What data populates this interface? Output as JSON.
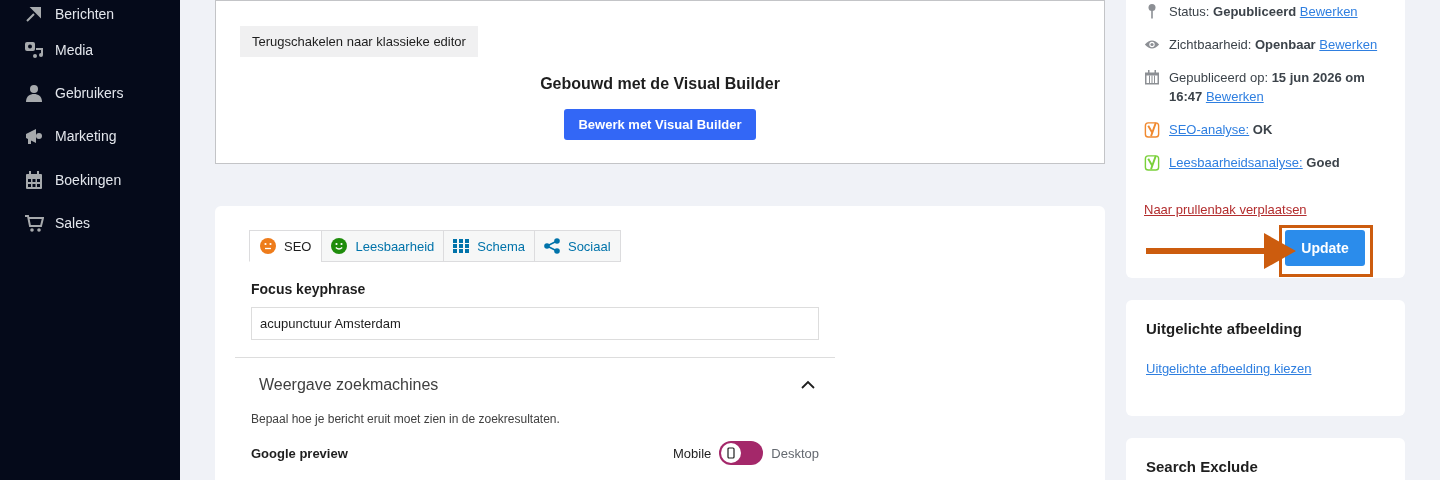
{
  "sidebar": {
    "items": [
      {
        "label": "Berichten"
      },
      {
        "label": "Media"
      },
      {
        "label": "Gebruikers"
      },
      {
        "label": "Marketing"
      },
      {
        "label": "Boekingen"
      },
      {
        "label": "Sales"
      }
    ]
  },
  "builder": {
    "switch_button": "Terugschakelen naar klassieke editor",
    "title": "Gebouwd met de Visual Builder",
    "edit_button": "Bewerk met Visual Builder"
  },
  "seo_box": {
    "tabs": [
      {
        "label": "SEO",
        "kind": "face",
        "color": "#ee7c1b",
        "selected": true
      },
      {
        "label": "Leesbaarheid",
        "kind": "face",
        "color": "#1e8c0b",
        "selected": false
      },
      {
        "label": "Schema",
        "kind": "grid",
        "selected": false
      },
      {
        "label": "Sociaal",
        "kind": "share",
        "selected": false
      }
    ],
    "focus_label": "Focus keyphrase",
    "focus_value": "acupunctuur Amsterdam",
    "section_title": "Weergave zoekmachines",
    "section_expanded": true,
    "section_description": "Bepaal hoe je bericht eruit moet zien in de zoekresultaten.",
    "preview_label": "Google preview",
    "preview_switch_desktop": false,
    "preview_modes": [
      {
        "label": "Mobile",
        "selected": true
      },
      {
        "label": "Desktop",
        "selected": false
      }
    ]
  },
  "publish": {
    "rows": [
      {
        "kind": "pin",
        "text": "Status: **Gepubliceerd**",
        "link": "Bewerken"
      },
      {
        "kind": "eye",
        "text": "Zichtbaarheid: **Openbaar**",
        "link": "Bewerken"
      },
      {
        "kind": "calendar",
        "text": "Gepubliceerd op: **15 jun 2026 om 16:47**",
        "link": "Bewerken"
      },
      {
        "kind": "score",
        "link": "SEO-analyse:",
        "text": "**OK**",
        "color": "#f0892f"
      },
      {
        "kind": "score",
        "link": "Leesbaarheidsanalyse:",
        "text": "**Goed**",
        "color": "#7ad03a"
      }
    ],
    "trash_link": "Naar prullenbak verplaatsen",
    "update_button": "Update"
  },
  "featured_image": {
    "title": "Uitgelichte afbeelding",
    "link": "Uitgelichte afbeelding kiezen"
  },
  "search_exclude": {
    "title": "Search Exclude"
  }
}
